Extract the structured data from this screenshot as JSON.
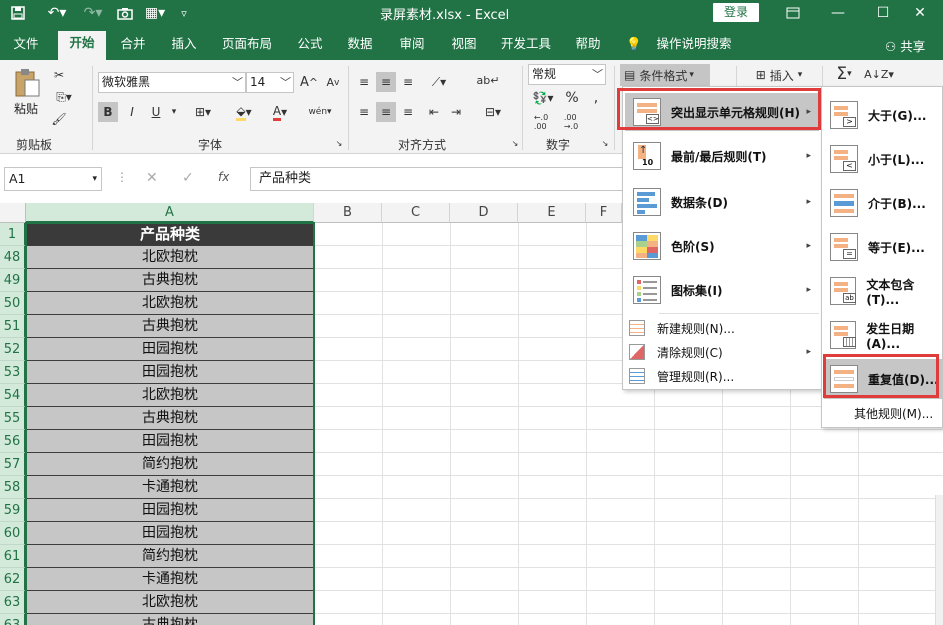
{
  "window": {
    "title": "录屏素材.xlsx  -  Excel",
    "login_label": "登录"
  },
  "tabs": [
    "文件",
    "开始",
    "合并",
    "插入",
    "页面布局",
    "公式",
    "数据",
    "审阅",
    "视图",
    "开发工具",
    "帮助"
  ],
  "search_label": "操作说明搜索",
  "share_label": "共享",
  "ribbon": {
    "paste_label": "粘贴",
    "clipboard_label": "剪贴板",
    "font_name": "微软雅黑",
    "font_size": "14",
    "bold": "B",
    "italic": "I",
    "underline": "U",
    "font_label": "字体",
    "align_label": "对齐方式",
    "number_format": "常规",
    "number_label": "数字",
    "cond_format_label": "条件格式",
    "insert_label": "插入"
  },
  "formula_bar": {
    "name_box": "A1",
    "fx": "fx",
    "content": "产品种类"
  },
  "columns": [
    "A",
    "B",
    "C",
    "D",
    "E",
    "F"
  ],
  "rows": [
    {
      "num": "1",
      "value": "产品种类"
    },
    {
      "num": "48",
      "value": "北欧抱枕"
    },
    {
      "num": "49",
      "value": "古典抱枕"
    },
    {
      "num": "50",
      "value": "北欧抱枕"
    },
    {
      "num": "50",
      "value": "古典抱枕"
    },
    {
      "num": "51",
      "value": "田园抱枕"
    },
    {
      "num": "52",
      "value": "田园抱枕"
    },
    {
      "num": "53",
      "value": "北欧抱枕"
    },
    {
      "num": "54",
      "value": "古典抱枕"
    },
    {
      "num": "55",
      "value": "田园抱枕"
    },
    {
      "num": "56",
      "value": "简约抱枕"
    },
    {
      "num": "57",
      "value": "卡通抱枕"
    },
    {
      "num": "58",
      "value": "田园抱枕"
    },
    {
      "num": "59",
      "value": "田园抱枕"
    },
    {
      "num": "60",
      "value": "简约抱枕"
    },
    {
      "num": "61",
      "value": "卡通抱枕"
    },
    {
      "num": "62",
      "value": "北欧抱枕"
    },
    {
      "num": "63",
      "value": "古典抱枕"
    }
  ],
  "cond_menu": {
    "highlight": "突出显示单元格规则(H)",
    "topbottom": "最前/最后规则(T)",
    "databar": "数据条(D)",
    "colorscale": "色阶(S)",
    "iconset": "图标集(I)",
    "newrule": "新建规则(N)...",
    "clearrule": "清除规则(C)",
    "managerule": "管理规则(R)..."
  },
  "sub_menu": {
    "greater": "大于(G)...",
    "less": "小于(L)...",
    "between": "介于(B)...",
    "equal": "等于(E)...",
    "textcontains": "文本包含(T)...",
    "dateoccur": "发生日期(A)...",
    "duplicate": "重复值(D)...",
    "more": "其他规则(M)..."
  },
  "colors": {
    "excel_green": "#217346",
    "highlight_red": "#e03c3c"
  }
}
